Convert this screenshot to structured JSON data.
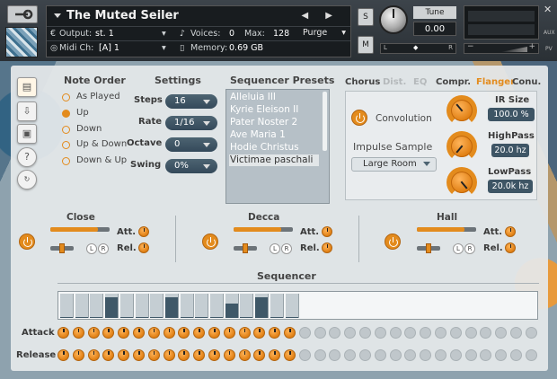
{
  "header": {
    "instrument_name": "The Muted Seiler",
    "output_label": "Output:",
    "output_value": "st. 1",
    "midi_label": "Midi Ch:",
    "midi_value": "[A]  1",
    "voices_label": "Voices:",
    "voices_value": "0",
    "max_label": "Max:",
    "max_value": "128",
    "memory_label": "Memory:",
    "memory_value": "0.69 GB",
    "purge_label": "Purge",
    "solo_label": "S",
    "mute_label": "M",
    "tune_label": "Tune",
    "tune_value": "0.00",
    "pan_left": "L",
    "pan_right": "R",
    "vol_minus": "−",
    "vol_plus": "+",
    "aux_label": "AUX",
    "pv_label": "PV"
  },
  "note_order": {
    "title": "Note Order",
    "options": [
      "As Played",
      "Up",
      "Down",
      "Up & Down",
      "Down & Up"
    ],
    "selected": "Up"
  },
  "settings": {
    "title": "Settings",
    "steps_label": "Steps",
    "steps_value": "16",
    "rate_label": "Rate",
    "rate_value": "1/16",
    "octave_label": "Octave",
    "octave_value": "0",
    "swing_label": "Swing",
    "swing_value": "0%"
  },
  "presets": {
    "title": "Sequencer Presets",
    "items": [
      "Alleluia III",
      "Kyrie Eleison II",
      "Pater Noster 2",
      "Ave Maria 1",
      "Hodie Christus",
      "Victimae paschali"
    ],
    "selected": "Victimae paschali"
  },
  "effects": {
    "tabs": [
      "Chorus",
      "Dist.",
      "EQ",
      "Compr.",
      "Flanger",
      "Conu."
    ],
    "active_tab": "Flanger",
    "convolution_label": "Convolution",
    "impulse_title": "Impulse Sample",
    "impulse_value": "Large Room",
    "ir_size_label": "IR Size",
    "ir_size_value": "100.0 %",
    "highpass_label": "HighPass",
    "highpass_value": "20.0 hz",
    "lowpass_label": "LowPass",
    "lowpass_value": "20.0k hz"
  },
  "mics": [
    {
      "name": "Close",
      "att_label": "Att.",
      "rel_label": "Rel.",
      "level": 0.8
    },
    {
      "name": "Decca",
      "att_label": "Att.",
      "rel_label": "Rel.",
      "level": 0.8
    },
    {
      "name": "Hall",
      "att_label": "Att.",
      "rel_label": "Rel.",
      "level": 0.8
    }
  ],
  "sequencer": {
    "title": "Sequencer",
    "attack_label": "Attack",
    "release_label": "Release",
    "active_steps": 16,
    "total_steps": 32,
    "step_levels": [
      0.05,
      0.05,
      0.05,
      0.85,
      0.05,
      0.05,
      0.05,
      0.85,
      0.05,
      0.05,
      0.05,
      0.6,
      0.05,
      0.85,
      0.05,
      0.05
    ]
  },
  "colors": {
    "accent": "#e38b1d",
    "panel": "#e4e8ea",
    "dark_pill": "#3e5565"
  }
}
